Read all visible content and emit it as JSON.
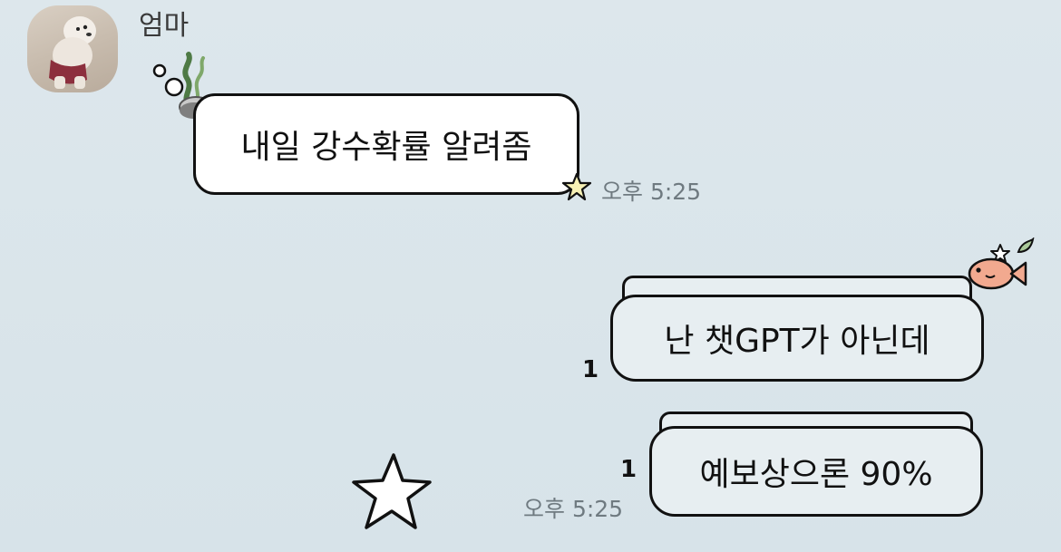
{
  "chat": {
    "sender_name": "엄마"
  },
  "messages": {
    "incoming": {
      "text": "내일 강수확률 알려좀",
      "time": "오후 5:25"
    },
    "outgoing_1": {
      "text": "난 챗GPT가 아닌데",
      "unread": "1"
    },
    "outgoing_2": {
      "text": "예보상으론 90%",
      "unread": "1",
      "time": "오후 5:25"
    }
  },
  "icons": {
    "avatar": "dog-photo-avatar",
    "incoming_decoration": "seaweed-bubbles-icon",
    "incoming_tail": "star-icon",
    "outgoing_decoration": "fish-icon",
    "floating": "star-outline-icon"
  },
  "colors": {
    "background": "#dde7ec",
    "bubble_in": "#ffffff",
    "bubble_out": "#e7eef1",
    "outline": "#111111",
    "timestamp": "#6f7a80"
  }
}
